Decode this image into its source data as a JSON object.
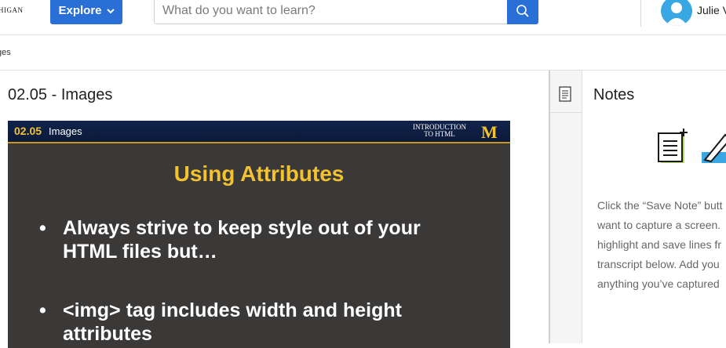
{
  "header": {
    "logo_text": "HIGAN",
    "explore_label": "Explore",
    "search_placeholder": "What do you want to learn?",
    "user_name": "Julie V"
  },
  "breadcrumb": {
    "text": "ges"
  },
  "lesson": {
    "title": "02.05 - Images"
  },
  "video": {
    "lesson_number": "02.05",
    "lesson_name": "Images",
    "course_line1": "INTRODUCTION",
    "course_line2": "TO HTML",
    "brand_mark": "M",
    "slide_title": "Using Attributes",
    "bullets": [
      "Always strive to keep style out of your HTML files but…",
      "<img> tag includes width and height attributes"
    ]
  },
  "notes": {
    "title": "Notes",
    "help_lines": [
      "Click the “Save Note” butt",
      "want to capture a screen.",
      "highlight and save lines fr",
      "transcript below. Add you",
      "anything you’ve captured"
    ]
  },
  "colors": {
    "primary_blue": "#2a6fd6",
    "slide_yellow": "#f2c230",
    "slide_bar_navy": "#11234b",
    "slide_bg": "#3b3838",
    "avatar_blue": "#39a7e3"
  }
}
